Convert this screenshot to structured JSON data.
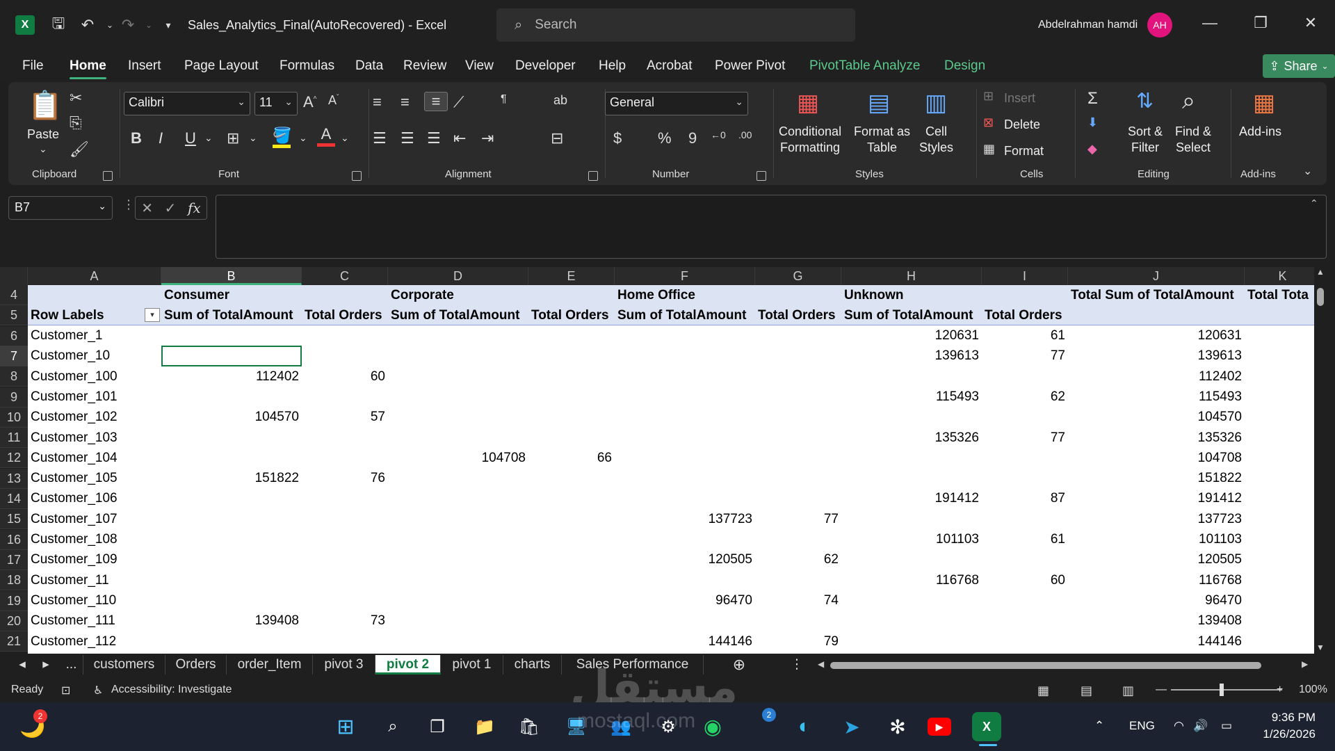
{
  "titlebar": {
    "app_logo": "X",
    "title": "Sales_Analytics_Final(AutoRecovered)  -  Excel",
    "search_placeholder": "Search",
    "user_name": "Abdelrahman hamdi",
    "user_initials": "AH"
  },
  "menu": {
    "tabs": [
      "File",
      "Home",
      "Insert",
      "Page Layout",
      "Formulas",
      "Data",
      "Review",
      "View",
      "Developer",
      "Help",
      "Acrobat",
      "Power Pivot",
      "PivotTable Analyze",
      "Design"
    ],
    "active": "Home",
    "share_label": "Share"
  },
  "ribbon": {
    "clipboard": {
      "paste": "Paste",
      "label": "Clipboard"
    },
    "font": {
      "name": "Calibri",
      "size": "11",
      "label": "Font",
      "bold": "B",
      "italic": "I",
      "underline": "U"
    },
    "alignment": {
      "label": "Alignment"
    },
    "number": {
      "format": "General",
      "label": "Number",
      "currency": "$",
      "percent": "%",
      "comma": "9"
    },
    "styles": {
      "conditional": "Conditional\nFormatting",
      "format_table": "Format as\nTable",
      "cell_styles": "Cell\nStyles",
      "label": "Styles"
    },
    "cells": {
      "insert": "Insert",
      "delete": "Delete",
      "format": "Format",
      "label": "Cells"
    },
    "editing": {
      "sort": "Sort &\nFilter",
      "find": "Find &\nSelect",
      "label": "Editing",
      "sum": "Σ"
    },
    "addins": {
      "addins": "Add-ins",
      "label": "Add-ins"
    }
  },
  "formula_bar": {
    "name_box": "B7",
    "fx": "fx"
  },
  "grid": {
    "columns": [
      "A",
      "B",
      "C",
      "D",
      "E",
      "F",
      "G",
      "H",
      "I",
      "J",
      "K"
    ],
    "rows": [
      "4",
      "5",
      "6",
      "7",
      "8",
      "9",
      "10",
      "11",
      "12",
      "13",
      "14",
      "15",
      "16",
      "17",
      "18",
      "19",
      "20",
      "21"
    ],
    "selected_cell": "B7",
    "header_row4": {
      "b": "Consumer",
      "d": "Corporate",
      "f": "Home Office",
      "h": "Unknown",
      "j": "Total Sum of TotalAmount",
      "k": "Total Tota"
    },
    "header_row5": {
      "a": "Row Labels",
      "b": "Sum of TotalAmount",
      "c": "Total Orders",
      "d": "Sum of TotalAmount",
      "e": "Total Orders",
      "f": "Sum of TotalAmount",
      "g": "Total Orders",
      "h": "Sum of TotalAmount",
      "i": "Total Orders"
    },
    "data_rows": [
      {
        "a": "Customer_1",
        "b": "",
        "c": "",
        "d": "",
        "e": "",
        "f": "",
        "g": "",
        "h": "120631",
        "i": "61",
        "j": "120631"
      },
      {
        "a": "Customer_10",
        "b": "",
        "c": "",
        "d": "",
        "e": "",
        "f": "",
        "g": "",
        "h": "139613",
        "i": "77",
        "j": "139613"
      },
      {
        "a": "Customer_100",
        "b": "112402",
        "c": "60",
        "d": "",
        "e": "",
        "f": "",
        "g": "",
        "h": "",
        "i": "",
        "j": "112402"
      },
      {
        "a": "Customer_101",
        "b": "",
        "c": "",
        "d": "",
        "e": "",
        "f": "",
        "g": "",
        "h": "115493",
        "i": "62",
        "j": "115493"
      },
      {
        "a": "Customer_102",
        "b": "104570",
        "c": "57",
        "d": "",
        "e": "",
        "f": "",
        "g": "",
        "h": "",
        "i": "",
        "j": "104570"
      },
      {
        "a": "Customer_103",
        "b": "",
        "c": "",
        "d": "",
        "e": "",
        "f": "",
        "g": "",
        "h": "135326",
        "i": "77",
        "j": "135326"
      },
      {
        "a": "Customer_104",
        "b": "",
        "c": "",
        "d": "104708",
        "e": "66",
        "f": "",
        "g": "",
        "h": "",
        "i": "",
        "j": "104708"
      },
      {
        "a": "Customer_105",
        "b": "151822",
        "c": "76",
        "d": "",
        "e": "",
        "f": "",
        "g": "",
        "h": "",
        "i": "",
        "j": "151822"
      },
      {
        "a": "Customer_106",
        "b": "",
        "c": "",
        "d": "",
        "e": "",
        "f": "",
        "g": "",
        "h": "191412",
        "i": "87",
        "j": "191412"
      },
      {
        "a": "Customer_107",
        "b": "",
        "c": "",
        "d": "",
        "e": "",
        "f": "137723",
        "g": "77",
        "h": "",
        "i": "",
        "j": "137723"
      },
      {
        "a": "Customer_108",
        "b": "",
        "c": "",
        "d": "",
        "e": "",
        "f": "",
        "g": "",
        "h": "101103",
        "i": "61",
        "j": "101103"
      },
      {
        "a": "Customer_109",
        "b": "",
        "c": "",
        "d": "",
        "e": "",
        "f": "120505",
        "g": "62",
        "h": "",
        "i": "",
        "j": "120505"
      },
      {
        "a": "Customer_11",
        "b": "",
        "c": "",
        "d": "",
        "e": "",
        "f": "",
        "g": "",
        "h": "116768",
        "i": "60",
        "j": "116768"
      },
      {
        "a": "Customer_110",
        "b": "",
        "c": "",
        "d": "",
        "e": "",
        "f": "96470",
        "g": "74",
        "h": "",
        "i": "",
        "j": "96470"
      },
      {
        "a": "Customer_111",
        "b": "139408",
        "c": "73",
        "d": "",
        "e": "",
        "f": "",
        "g": "",
        "h": "",
        "i": "",
        "j": "139408"
      },
      {
        "a": "Customer_112",
        "b": "",
        "c": "",
        "d": "",
        "e": "",
        "f": "144146",
        "g": "79",
        "h": "",
        "i": "",
        "j": "144146"
      }
    ]
  },
  "sheet_tabs": {
    "more": "...",
    "tabs": [
      "customers",
      "Orders",
      "order_Item",
      "pivot 3",
      "pivot 2",
      "pivot 1",
      "charts",
      "Sales Performance"
    ],
    "active": "pivot 2"
  },
  "status": {
    "ready": "Ready",
    "accessibility": "Accessibility: Investigate",
    "zoom": "100%"
  },
  "watermark": {
    "arabic": "مستقل",
    "latin": "mostaql.com"
  },
  "taskbar": {
    "lang": "ENG",
    "time": "9:36 PM",
    "date": "1/26/2026",
    "weather_badge": "2",
    "whatsapp_badge": "2"
  }
}
